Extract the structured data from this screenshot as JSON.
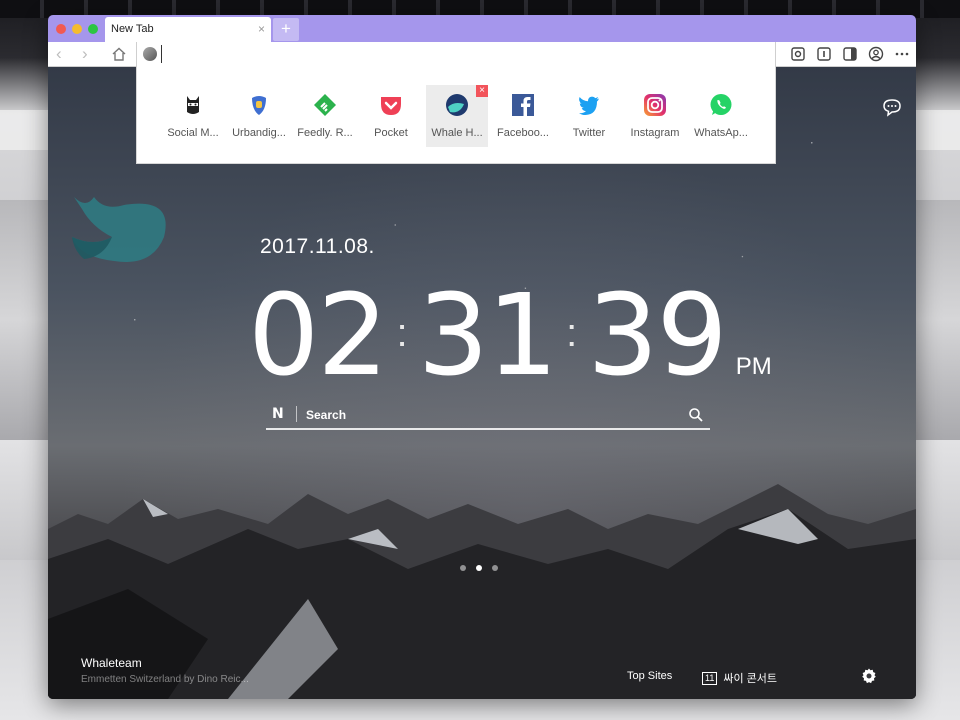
{
  "tab": {
    "title": "New Tab",
    "close": "×",
    "new_tab": "+"
  },
  "nav": {
    "back": "‹",
    "forward": "›"
  },
  "omnibox": {
    "value": ""
  },
  "top_sites": [
    {
      "label": "Social M...",
      "icon": "ninja-icon"
    },
    {
      "label": "Urbandig...",
      "icon": "urbandig-icon"
    },
    {
      "label": "Feedly. R...",
      "icon": "feedly-icon"
    },
    {
      "label": "Pocket",
      "icon": "pocket-icon"
    },
    {
      "label": "Whale H...",
      "icon": "whale-icon",
      "close": "×"
    },
    {
      "label": "Faceboo...",
      "icon": "facebook-icon"
    },
    {
      "label": "Twitter",
      "icon": "twitter-icon"
    },
    {
      "label": "Instagram",
      "icon": "instagram-icon"
    },
    {
      "label": "WhatsAp...",
      "icon": "whatsapp-icon"
    }
  ],
  "date": "2017.11.08.",
  "clock": {
    "hours": "02",
    "minutes": "31",
    "seconds": "39",
    "separator": ":",
    "ampm": "PM"
  },
  "search": {
    "brand": "N",
    "placeholder": "Search"
  },
  "credit": {
    "title": "Whaleteam",
    "subtitle": "Emmetten Switzerland by Dino Reic..."
  },
  "bottom": {
    "top_sites": "Top Sites",
    "badge": "11",
    "concert": "싸이 콘서트"
  },
  "colors": {
    "accent": "#a596ec",
    "close_red": "#f2545b"
  }
}
